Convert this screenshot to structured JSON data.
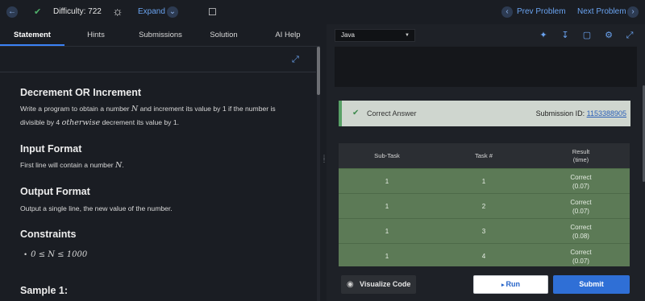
{
  "topbar": {
    "back_icon": "arrow-left",
    "difficulty_check_icon": "check",
    "difficulty_label": "Difficulty: 722",
    "theme_icon": "sun",
    "expand_label": "Expand",
    "expand_icon": "chevron-down",
    "bookmark_icon": "bookmark",
    "prev_label": "Prev Problem",
    "next_label": "Next Problem"
  },
  "tabs": [
    {
      "label": "Statement",
      "active": true
    },
    {
      "label": "Hints",
      "active": false
    },
    {
      "label": "Submissions",
      "active": false
    },
    {
      "label": "Solution",
      "active": false
    },
    {
      "label": "AI Help",
      "active": false
    }
  ],
  "problem": {
    "title": "Decrement OR Increment",
    "statement_line1_a": "Write a program to obtain a number ",
    "statement_var_n": "N",
    "statement_line1_b": " and increment its value by 1 if the number is",
    "statement_line2_a": "divisible by 4 ",
    "statement_otherwise": "otherwise",
    "statement_line2_b": " decrement its value by 1.",
    "input_heading": "Input Format",
    "input_text_a": "First line will contain a number ",
    "input_var": "N",
    "input_text_b": ".",
    "output_heading": "Output Format",
    "output_text": "Output a single line, the new value of the number.",
    "constraints_heading": "Constraints",
    "constraint": "0 ≤ N ≤ 1000",
    "sample_heading": "Sample 1:"
  },
  "editor": {
    "language": "Java",
    "toolbar_icons": [
      "magic-wand",
      "download",
      "comment",
      "settings",
      "fullscreen"
    ]
  },
  "result": {
    "status": "Correct Answer",
    "submission_label": "Submission ID: ",
    "submission_id": "1153388905",
    "headers": {
      "subtask": "Sub-Task",
      "task": "Task #",
      "result": "Result",
      "time": "(time)"
    },
    "rows": [
      {
        "subtask": "1",
        "task": "1",
        "result": "Correct",
        "time": "(0.07)"
      },
      {
        "subtask": "1",
        "task": "2",
        "result": "Correct",
        "time": "(0.07)"
      },
      {
        "subtask": "1",
        "task": "3",
        "result": "Correct",
        "time": "(0.08)"
      },
      {
        "subtask": "1",
        "task": "4",
        "result": "Correct",
        "time": "(0.07)"
      }
    ]
  },
  "footer": {
    "visualize_label": "Visualize Code",
    "run_label": "Run",
    "submit_label": "Submit"
  },
  "colors": {
    "accent": "#3b82f6",
    "success": "#58a066",
    "row_green": "#5c7a56",
    "submit": "#2f6fd6"
  }
}
